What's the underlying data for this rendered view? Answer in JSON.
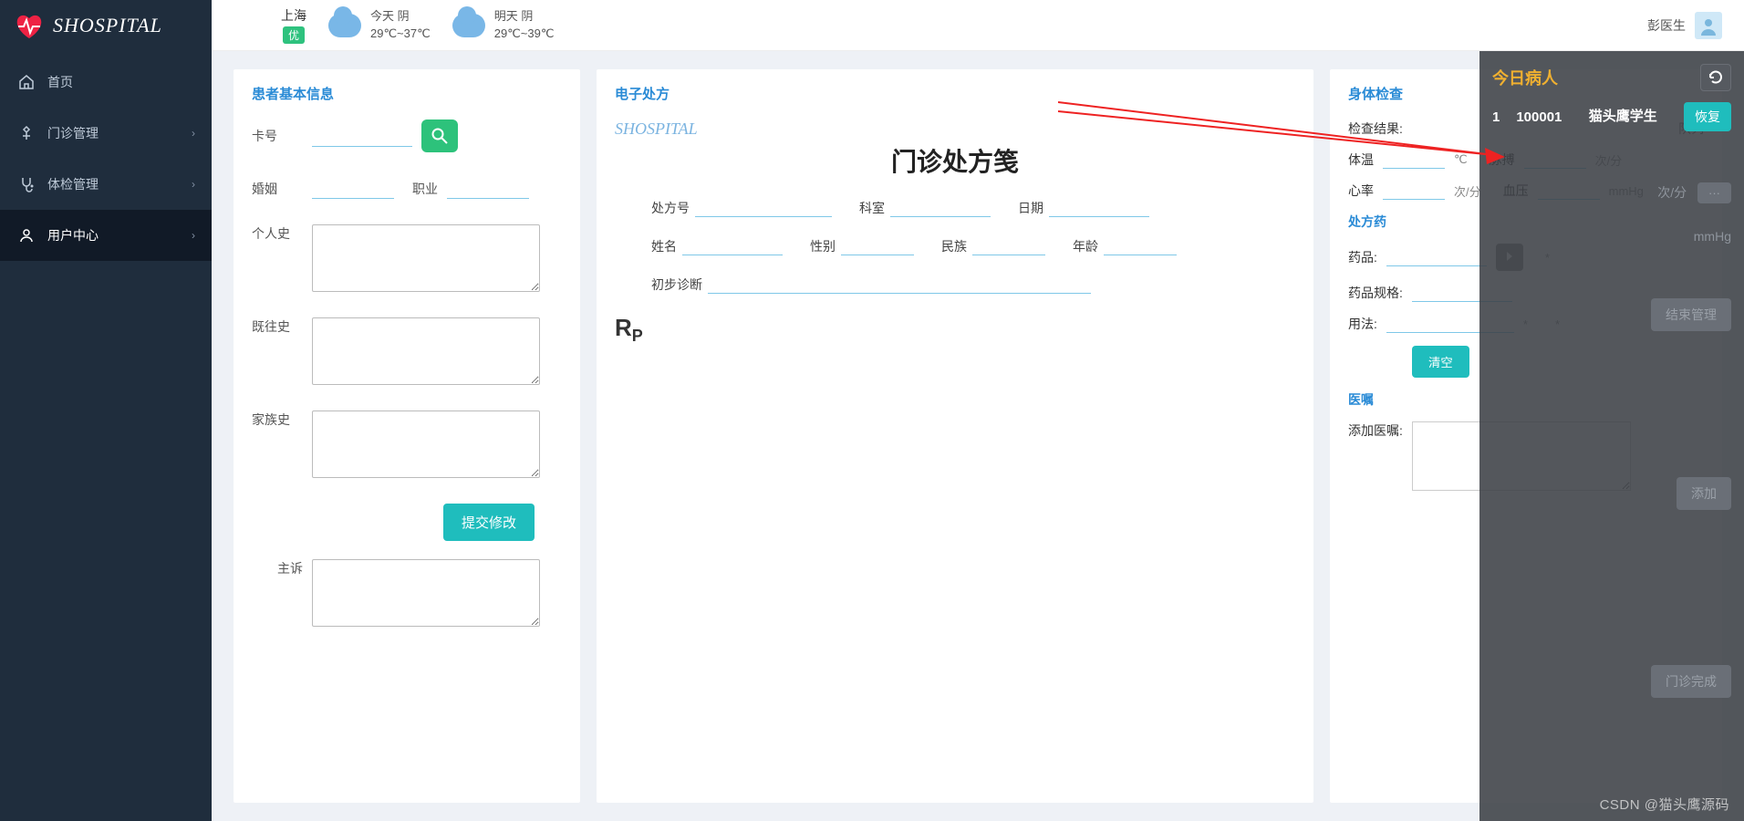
{
  "brand": {
    "name": "SHOSPITAL"
  },
  "weather": {
    "city": "上海",
    "air_quality": "优",
    "today": {
      "label": "今天 阴",
      "temp": "29℃~37℃"
    },
    "tomorrow": {
      "label": "明天 阴",
      "temp": "29℃~39℃"
    }
  },
  "user": {
    "name": "彭医生"
  },
  "sidebar": {
    "items": [
      {
        "label": "首页"
      },
      {
        "label": "门诊管理"
      },
      {
        "label": "体检管理"
      },
      {
        "label": "用户中心"
      }
    ]
  },
  "patient_panel": {
    "title": "患者基本信息",
    "card_label": "卡号",
    "marriage_label": "婚姻",
    "occupation_label": "职业",
    "personal_hx_label": "个人史",
    "past_hx_label": "既往史",
    "family_hx_label": "家族史",
    "chief_label": "主诉",
    "submit_label": "提交修改"
  },
  "rx_panel": {
    "title": "电子处方",
    "watermark": "SHOSPITAL",
    "heading": "门诊处方笺",
    "labels": {
      "rx_no": "处方号",
      "dept": "科室",
      "date": "日期",
      "name": "姓名",
      "gender": "性别",
      "ethnic": "民族",
      "age": "年龄",
      "dx": "初步诊断"
    }
  },
  "check_panel": {
    "title": "身体检查",
    "queue_label": "队列",
    "result_label": "检查结果:",
    "temp_label": "体温",
    "temp_unit": "℃",
    "pulse_label": "脉搏",
    "pulse_unit": "次/分",
    "hr_label": "心率",
    "hr_unit": "次/分",
    "bp_label": "血压",
    "bp_unit": "mmHg",
    "med_title": "处方药",
    "drug_label": "药品:",
    "spec_label": "药品规格:",
    "usage_label": "用法:",
    "clear_label": "清空",
    "order_title": "医嘱",
    "add_order_label": "添加医嘱:"
  },
  "right_panel": {
    "title": "今日病人",
    "row": {
      "seq": "1",
      "id": "100001",
      "name": "猫头鹰学生"
    },
    "restore_label": "恢复",
    "process_label1": "结束管理",
    "faded_hint": "次/分",
    "faded_hint2": "mmHg",
    "add_label": "添加",
    "bottom_label": "门诊完成"
  },
  "watermark": "CSDN @猫头鹰源码"
}
